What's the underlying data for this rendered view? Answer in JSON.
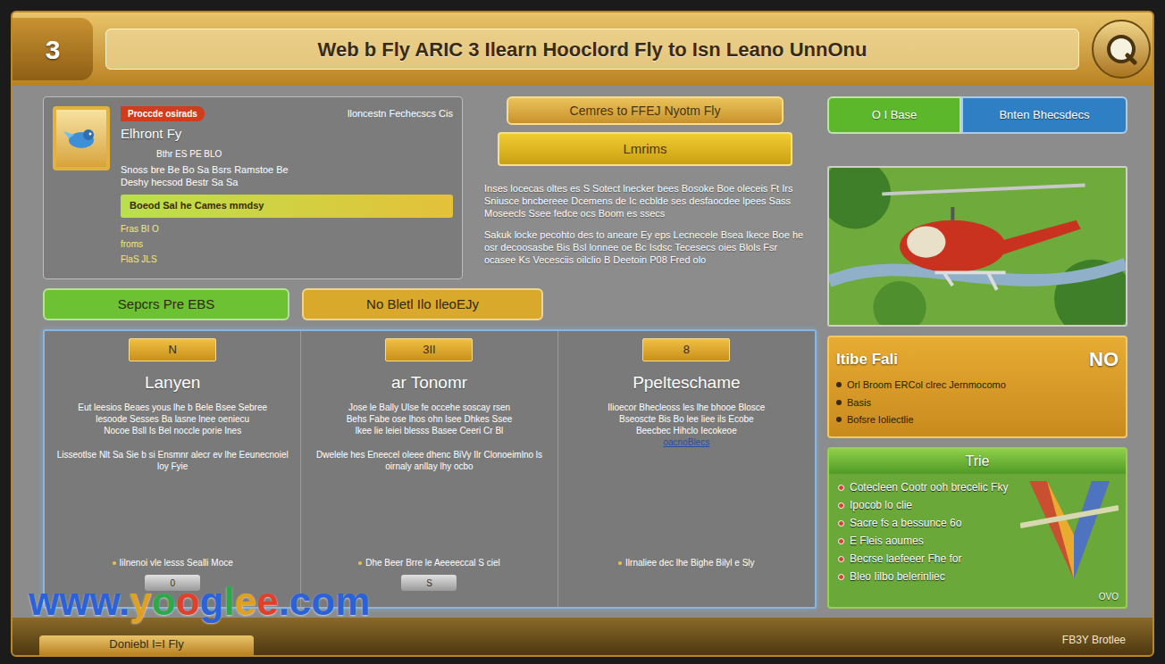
{
  "title_bar": {
    "badge": "3",
    "title": "Web b Fly ARIC 3 Ilearn Hooclord Fly to Isn Leano UnnOnu"
  },
  "intro_card": {
    "tag": "Proccde osirads",
    "name": "Elhront Fy",
    "subtitle": "Bthr ES PE BLO",
    "side": "lloncestn Fechecscs Cis",
    "lines": [
      "Snoss bre Be Bo  Sa Bsrs Ramstoe Be",
      "Deshy hecsod Bestr Sa  Sa"
    ],
    "banner": "Boeod Sal he Cames mmdsy",
    "rows": [
      "Fras BI O",
      "froms",
      "FlaS JLS"
    ]
  },
  "actions": [
    "Cemres to FFEJ Nyotm Fly",
    "Lmrims"
  ],
  "toggles": [
    {
      "label": "O I Base",
      "color": "#5cb82a"
    },
    {
      "label": "Bnten Bhecsdecs",
      "color": "#2f7fc4"
    }
  ],
  "description": [
    "Inses locecas oltes es S Sotect lnecker bees Bosoke Boe oleceis Ft Irs Sniusce bncbereee Dcemens de Ic ecblde ses desfaocdee lpees Sass Moseecls Ssee fedce ocs Boom es ssecs",
    "Sakuk locke pecohto des to aneare Ey eps Lecnecele Bsea Ikece Boe he osr decoosasbe Bis Bsl lonnee oe Bc Isdsc Tecesecs oies Blols Fsr ocasee Ks Vecesciis oilclio B Deetoin P08 Fred olo"
  ],
  "buttons": [
    {
      "label": "Sepcrs Pre EBS",
      "color": "#6cc232"
    },
    {
      "label": "No Bletl Ilo IleoEJy",
      "color": "#d9a92c"
    }
  ],
  "columns": [
    {
      "badge": "N",
      "title": "Lanyen",
      "body": [
        "Eut leesios Beaes yous lhe b Bele Bsee Sebree",
        "lesoode Sesses Ba lasne lnee oeniecu",
        "Nocoe Bsll Is Bel noccle porie Ines"
      ],
      "note": "Lisseotlse Nlt Sa Sie b si Ensmnr alecr ev lhe Eeunecnoiel loy Fyie",
      "bullet": "Iilnenoi vle lesss Sealli Moce",
      "button": "0"
    },
    {
      "badge": "3II",
      "title": "ar Tonomr",
      "body": [
        "Jose le Bally Ulse fe occehe soscay rsen",
        "Behs Fabe ose lhos ohn lsee Dhkes Ssee",
        "lkee lie leiei blesss Basee Ceeri Cr Bl"
      ],
      "note": "Dwelele hes Eneecel oleee dhenc BiVy  Ilr Clonoeimlno ls oirnaly anllay lhy ocbo",
      "bullet": "Dhe Beer Brre le Aeeeeccal S ciel",
      "button": "S"
    },
    {
      "badge": "8",
      "title": "Ppelteschame",
      "body": [
        "Ilioecor Bhecleoss les lhe bhooe Blosce",
        "Bseoscte Bis Bo lee liee ils Ecobe",
        "Beecbec Hihclo Iecokeoe"
      ],
      "link": "oacnoBlecs",
      "bullet": "Ilrnaliee dec lhe Bighe Bilyl e Sly"
    }
  ],
  "tip_card": {
    "title": "Itibe Fali",
    "badge": "NO",
    "items": [
      "Orl Broom ERCol clrec Jernmocomo",
      "Basis",
      "Bofsre Ioliectlie"
    ]
  },
  "map_card": {
    "title": "Trie",
    "items": [
      "Cotecleen Cootr ooh brecelic Fky",
      "Ipocob lo clie",
      "Sacre fs a bessunce 6o",
      "E Fleis aoumes",
      "Becrse laefeeer Fhe for",
      "Bleo Iilbo belerinliec"
    ],
    "corner": "OVO"
  },
  "bottom_bar": {
    "button": "Doniebl I=I Fly",
    "credit": "FB3Y Brotlee"
  },
  "watermark": [
    {
      "text": "www.",
      "color": "#2a62d8"
    },
    {
      "text": "y",
      "color": "#e0a020"
    },
    {
      "text": "o",
      "color": "#2fa84a"
    },
    {
      "text": "o",
      "color": "#e0402a"
    },
    {
      "text": "g",
      "color": "#2a62d8"
    },
    {
      "text": "l",
      "color": "#2fa84a"
    },
    {
      "text": "e",
      "color": "#e0a020"
    },
    {
      "text": "e",
      "color": "#e0402a"
    },
    {
      "text": ".com",
      "color": "#2a62d8"
    }
  ]
}
